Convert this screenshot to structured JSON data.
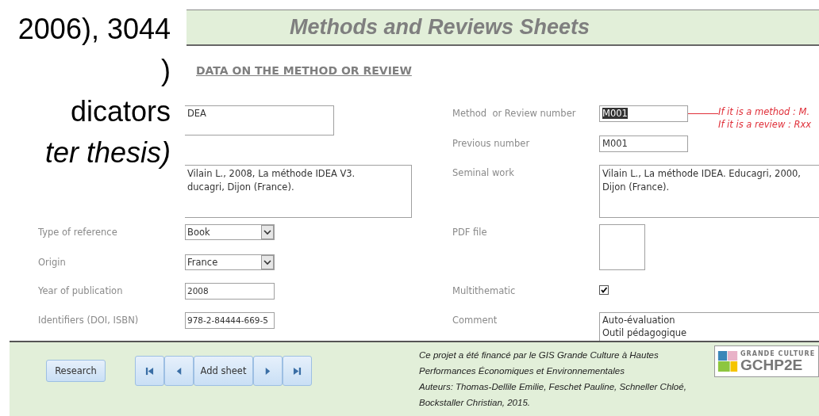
{
  "slide_text": {
    "lines": [
      {
        "text": "2006), 3044",
        "italic": false
      },
      {
        "text": ")",
        "italic": false
      },
      {
        "text": "dicators",
        "italic": false
      },
      {
        "text": "ter thesis)",
        "italic": true
      }
    ]
  },
  "form": {
    "title": "Methods and Reviews Sheets",
    "section_title": "DATA ON THE METHOD OR REVIEW",
    "name_field": {
      "value": "DEA"
    },
    "reference_field": {
      "value": "Vilain L., 2008, La méthode IDEA V3.\nducagri, Dijon (France)."
    },
    "number": {
      "label": "Method  or Review number",
      "value": "M001",
      "highlighted": true,
      "notes": [
        "If it is a method : M.",
        "If it is a review : Rxx"
      ]
    },
    "previous_number": {
      "label": "Previous number",
      "value": "M001"
    },
    "seminal_work": {
      "label": "Seminal work",
      "value": "Vilain L., La méthode IDEA. Educagri, 2000, Dijon (France)."
    },
    "type_of_reference": {
      "label": "Type of reference",
      "value": "Book"
    },
    "pdf_file": {
      "label": "PDF file"
    },
    "origin": {
      "label": "Origin",
      "value": "France"
    },
    "year": {
      "label": "Year of publication",
      "value": "2008"
    },
    "multithematic": {
      "label": "Multithematic",
      "checked": true
    },
    "identifiers": {
      "label": "Identifiers (DOI, ISBN)",
      "value": "978-2-84444-669-5"
    },
    "comment": {
      "label": "Comment",
      "value": "Auto-évaluation\nOutil pédagogique"
    }
  },
  "footer": {
    "research_button": "Research",
    "nav": [
      {
        "kind": "first"
      },
      {
        "kind": "prev"
      },
      {
        "kind": "label",
        "label": "Add sheet"
      },
      {
        "kind": "next"
      },
      {
        "kind": "last"
      }
    ],
    "credits": "Ce projet a été financé par le GIS Grande Culture à Hautes Performances Économiques et Environnementales\nAuteurs:  Thomas-Dellile Emilie,  Feschet Pauline, Schneller Chloé, Bockstaller Christian, 2015.",
    "logo": {
      "top": "GRANDE CULTURE",
      "main": "GCHP2E"
    }
  }
}
